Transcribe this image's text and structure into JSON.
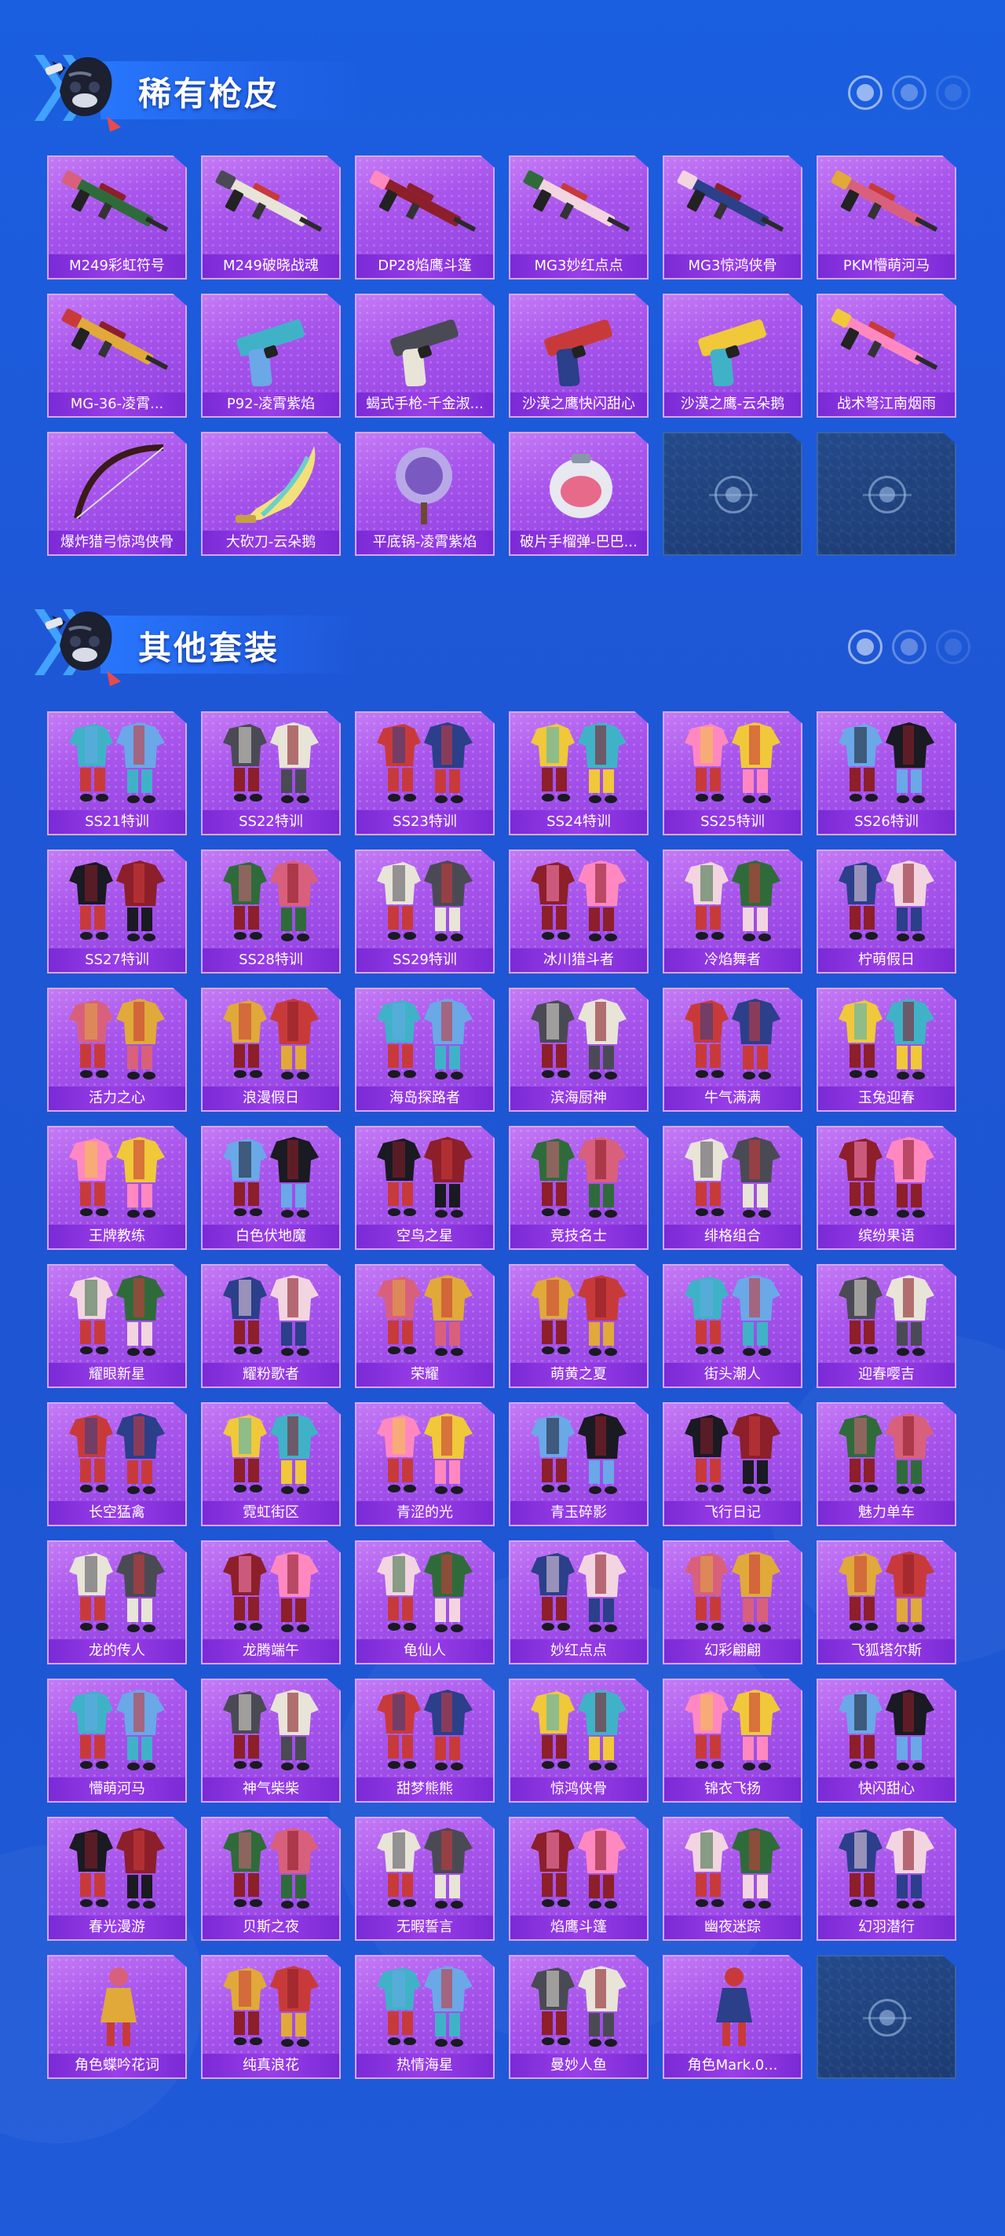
{
  "sections": [
    {
      "title": "稀有枪皮",
      "items": [
        {
          "label": "M249彩虹符号",
          "kind": "weapon"
        },
        {
          "label": "M249破晓战魂",
          "kind": "weapon"
        },
        {
          "label": "DP28焰鹰斗篷",
          "kind": "weapon"
        },
        {
          "label": "MG3妙红点点",
          "kind": "weapon"
        },
        {
          "label": "MG3惊鸿侠骨",
          "kind": "weapon"
        },
        {
          "label": "PKM懵萌河马",
          "kind": "weapon"
        },
        {
          "label": "MG-36-凌霄...",
          "kind": "weapon"
        },
        {
          "label": "P92-凌霄紫焰",
          "kind": "pistol"
        },
        {
          "label": "蝎式手枪-千金淑...",
          "kind": "pistol"
        },
        {
          "label": "沙漠之鹰快闪甜心",
          "kind": "pistol"
        },
        {
          "label": "沙漠之鹰-云朵鹅",
          "kind": "pistol"
        },
        {
          "label": "战术弩江南烟雨",
          "kind": "weapon"
        },
        {
          "label": "爆炸猎弓惊鸿侠骨",
          "kind": "bow"
        },
        {
          "label": "大砍刀-云朵鹅",
          "kind": "blade"
        },
        {
          "label": "平底锅-凌霄紫焰",
          "kind": "pan"
        },
        {
          "label": "破片手榴弹-巴巴...",
          "kind": "grenade"
        },
        {
          "label": "",
          "kind": "empty"
        },
        {
          "label": "",
          "kind": "empty"
        }
      ]
    },
    {
      "title": "其他套装",
      "items": [
        {
          "label": "SS21特训",
          "kind": "outfit"
        },
        {
          "label": "SS22特训",
          "kind": "outfit"
        },
        {
          "label": "SS23特训",
          "kind": "outfit"
        },
        {
          "label": "SS24特训",
          "kind": "outfit"
        },
        {
          "label": "SS25特训",
          "kind": "outfit"
        },
        {
          "label": "SS26特训",
          "kind": "outfit"
        },
        {
          "label": "SS27特训",
          "kind": "outfit"
        },
        {
          "label": "SS28特训",
          "kind": "outfit"
        },
        {
          "label": "SS29特训",
          "kind": "outfit"
        },
        {
          "label": "冰川猎斗者",
          "kind": "outfit"
        },
        {
          "label": "冷焰舞者",
          "kind": "outfit"
        },
        {
          "label": "柠萌假日",
          "kind": "outfit"
        },
        {
          "label": "活力之心",
          "kind": "outfit"
        },
        {
          "label": "浪漫假日",
          "kind": "outfit"
        },
        {
          "label": "海岛探路者",
          "kind": "outfit"
        },
        {
          "label": "滨海厨神",
          "kind": "outfit"
        },
        {
          "label": "牛气满满",
          "kind": "outfit"
        },
        {
          "label": "玉兔迎春",
          "kind": "outfit"
        },
        {
          "label": "王牌教练",
          "kind": "outfit"
        },
        {
          "label": "白色伏地魔",
          "kind": "outfit"
        },
        {
          "label": "空鸟之星",
          "kind": "outfit"
        },
        {
          "label": "竞技名士",
          "kind": "outfit"
        },
        {
          "label": "绯格组合",
          "kind": "outfit"
        },
        {
          "label": "缤纷果语",
          "kind": "outfit"
        },
        {
          "label": "耀眼新星",
          "kind": "outfit"
        },
        {
          "label": "耀粉歌者",
          "kind": "outfit"
        },
        {
          "label": "荣耀",
          "kind": "outfit"
        },
        {
          "label": "萌黄之夏",
          "kind": "outfit"
        },
        {
          "label": "街头潮人",
          "kind": "outfit"
        },
        {
          "label": "迎春嘤吉",
          "kind": "outfit"
        },
        {
          "label": "长空猛禽",
          "kind": "outfit"
        },
        {
          "label": "霓虹街区",
          "kind": "outfit"
        },
        {
          "label": "青涩的光",
          "kind": "outfit"
        },
        {
          "label": "青玉碎影",
          "kind": "outfit"
        },
        {
          "label": "飞行日记",
          "kind": "outfit"
        },
        {
          "label": "魅力单车",
          "kind": "outfit"
        },
        {
          "label": "龙的传人",
          "kind": "outfit"
        },
        {
          "label": "龙腾端午",
          "kind": "outfit"
        },
        {
          "label": "龟仙人",
          "kind": "outfit"
        },
        {
          "label": "妙红点点",
          "kind": "outfit"
        },
        {
          "label": "幻彩翩翩",
          "kind": "outfit"
        },
        {
          "label": "飞狐塔尔斯",
          "kind": "outfit"
        },
        {
          "label": "懵萌河马",
          "kind": "outfit"
        },
        {
          "label": "神气柴柴",
          "kind": "outfit"
        },
        {
          "label": "甜梦熊熊",
          "kind": "outfit"
        },
        {
          "label": "惊鸿侠骨",
          "kind": "outfit"
        },
        {
          "label": "锦衣飞扬",
          "kind": "outfit"
        },
        {
          "label": "快闪甜心",
          "kind": "outfit"
        },
        {
          "label": "春光漫游",
          "kind": "outfit"
        },
        {
          "label": "贝斯之夜",
          "kind": "outfit"
        },
        {
          "label": "无暇誓言",
          "kind": "outfit"
        },
        {
          "label": "焰鹰斗篷",
          "kind": "outfit"
        },
        {
          "label": "幽夜迷踪",
          "kind": "outfit"
        },
        {
          "label": "幻羽潜行",
          "kind": "outfit"
        },
        {
          "label": "角色蝶吟花词",
          "kind": "figure"
        },
        {
          "label": "纯真浪花",
          "kind": "outfit"
        },
        {
          "label": "热情海星",
          "kind": "outfit"
        },
        {
          "label": "曼妙人鱼",
          "kind": "outfit"
        },
        {
          "label": "角色Mark.0...",
          "kind": "figure"
        },
        {
          "label": "",
          "kind": "empty"
        }
      ]
    }
  ],
  "palette": [
    "#2f6b3a",
    "#e8e4d8",
    "#8c1f2a",
    "#f2d5e0",
    "#2b3f8a",
    "#d9607c",
    "#e0a93a",
    "#3fb2c8",
    "#4a4a55",
    "#c83a3a",
    "#f0c83a",
    "#ff88c0",
    "#6aa8e8",
    "#1a1a22"
  ]
}
